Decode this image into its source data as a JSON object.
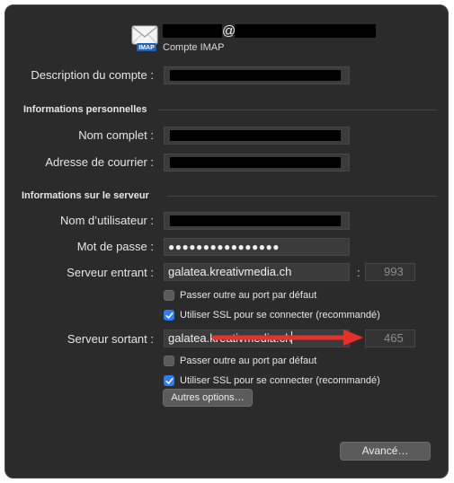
{
  "header": {
    "at_sign": "@",
    "account_type": "Compte IMAP",
    "icon": "mail-envelope-icon",
    "icon_badge": "IMAP"
  },
  "account": {
    "description_label": "Description du compte :"
  },
  "personal": {
    "section_title": "Informations personnelles",
    "full_name_label": "Nom complet :",
    "email_label": "Adresse de courrier :"
  },
  "server": {
    "section_title": "Informations sur le serveur",
    "username_label": "Nom d’utilisateur :",
    "password_label": "Mot de passe :",
    "password_value": "●●●●●●●●●●●●●●●●",
    "incoming_label": "Serveur entrant :",
    "incoming_value": "galatea.kreativmedia.ch",
    "incoming_port": "993",
    "incoming_default_port_label": "Passer outre au port par défaut",
    "incoming_default_port_checked": false,
    "incoming_ssl_label": "Utiliser SSL pour se connecter (recommandé)",
    "incoming_ssl_checked": true,
    "outgoing_label": "Serveur sortant :",
    "outgoing_value": "galatea.kreativmedia.ch",
    "outgoing_port": "465",
    "outgoing_default_port_label": "Passer outre au port par défaut",
    "outgoing_default_port_checked": false,
    "outgoing_ssl_label": "Utiliser SSL pour se connecter (recommandé)",
    "outgoing_ssl_checked": true,
    "more_options_label": "Autres options…",
    "port_separator": ":"
  },
  "footer": {
    "advanced_label": "Avancé…"
  },
  "colors": {
    "background": "#2b2b2b",
    "field": "#3b3b3b",
    "checkbox_on": "#2e7cf6",
    "arrow": "#e8302a"
  }
}
